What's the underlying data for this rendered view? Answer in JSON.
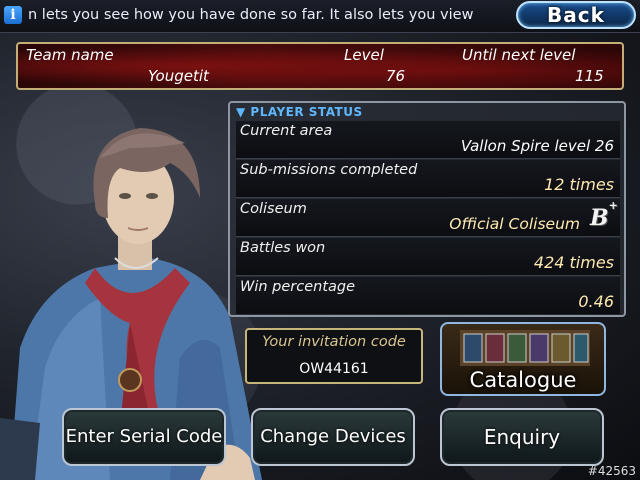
{
  "ticker": {
    "text": "n lets you see how you have done so far. It also lets you view"
  },
  "back_label": "Back",
  "team": {
    "name_label": "Team name",
    "name": "Yougetit",
    "level_label": "Level",
    "level": "76",
    "next_label": "Until next level",
    "next": "115"
  },
  "status": {
    "header": "▼ PLAYER STATUS",
    "rows": [
      {
        "label": "Current area",
        "value": "Vallon Spire level 26"
      },
      {
        "label": "Sub-missions completed",
        "value": "12 times"
      },
      {
        "label": "Coliseum",
        "value": "Official Coliseum"
      },
      {
        "label": "Battles won",
        "value": "424 times"
      },
      {
        "label": "Win percentage",
        "value": "0.46"
      }
    ],
    "rank": "B+"
  },
  "invitation": {
    "label": "Your invitation code",
    "code": "OW44161"
  },
  "catalogue_label": "Catalogue",
  "buttons": {
    "serial": "Enter Serial Code",
    "devices": "Change Devices",
    "enquiry": "Enquiry"
  },
  "watermark": "#42563",
  "colors": {
    "accent_blue": "#5fb8ff",
    "gold_border": "#c4ae77",
    "team_red": "#4a0b0c"
  },
  "icons": {
    "info": "info-icon",
    "rank": "rank-b-plus-icon"
  }
}
